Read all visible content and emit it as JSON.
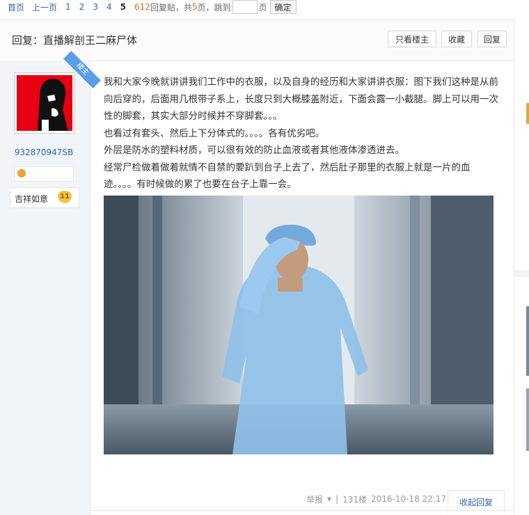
{
  "pager": {
    "first": "首页",
    "prev": "上一页",
    "pages": [
      "1",
      "2",
      "3",
      "4",
      "5"
    ],
    "current": "5",
    "reply_count": "612",
    "reply_label": "回复贴，共",
    "total_pages": "5",
    "pages_suffix": "页，跳到",
    "page_unit": "页",
    "confirm": "确定"
  },
  "thread": {
    "title": "回复：直播解剖王二麻尸体",
    "only_op": "只看楼主",
    "favorite": "收藏",
    "reply": "回复"
  },
  "user": {
    "op_tag": "楼主",
    "name": "932870947SB",
    "level_name": "吉祥如意",
    "level": "11"
  },
  "post": {
    "paragraphs": [
      "我和大家今晚就讲讲我们工作中的衣服，以及自身的经历和大家讲讲衣服：图下我们这种是从前向后穿的，后面用几根带子系上，长度只到大概膝盖附近，下面会露一小截腿。脚上可以用一次性的脚套，其实大部分时候并不穿脚套。。。",
      "也看过有套头、然后上下分体式的。。。。各有优劣吧。",
      "外层是防水的塑料材质，可以很有效的防止血液或者其他液体渗透进去。",
      "经常尸检做着做着就情不自禁的要趴到台子上去了，然后肚子那里的衣服上就是一片的血迹。。。。有时候做的累了也要在台子上靠一会。"
    ],
    "report": "举报",
    "floor": "131楼",
    "time": "2016-10-18 22:17",
    "collapse": "收起回复"
  },
  "colors": {
    "link": "#2d64b3",
    "accent_orange": "#e06c1d",
    "op_ribbon": "#5a9ee8",
    "avatar_red": "#e60012"
  }
}
